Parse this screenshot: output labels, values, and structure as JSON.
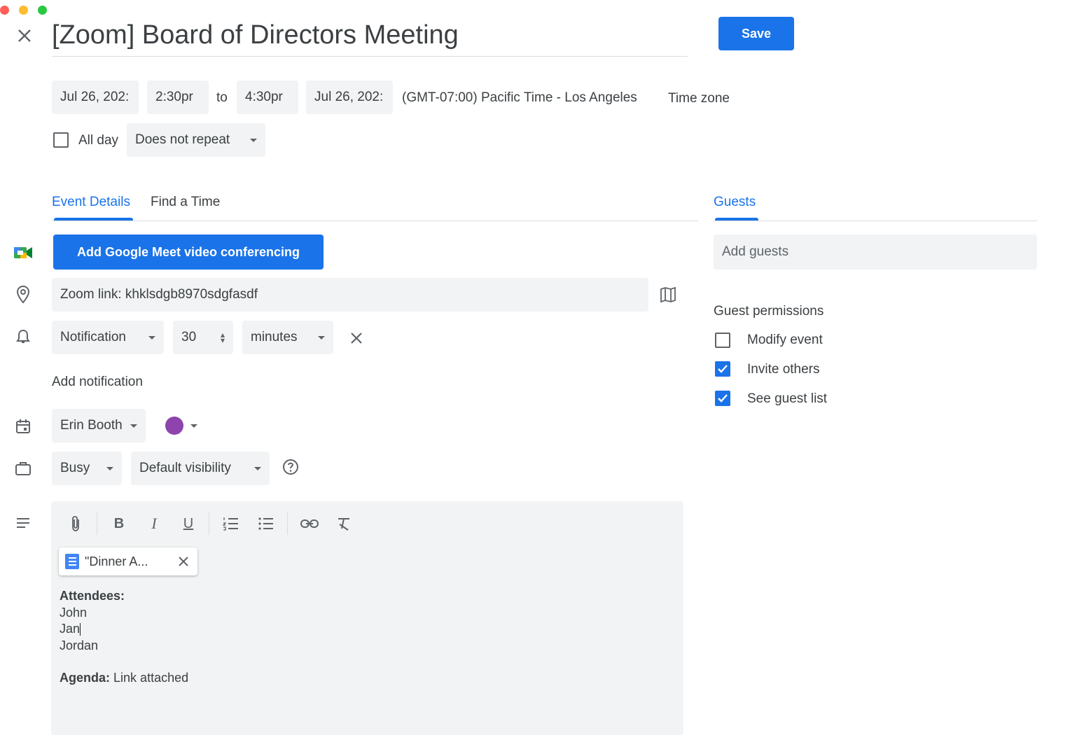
{
  "window": {
    "dots": [
      "#ff5f57",
      "#febc2e",
      "#28c840"
    ]
  },
  "header": {
    "title": "[Zoom] Board of Directors Meeting",
    "save_label": "Save"
  },
  "datetime": {
    "start_date": "Jul 26, 202:",
    "start_time": "2:30pr",
    "to_label": "to",
    "end_time": "4:30pr",
    "end_date": "Jul 26, 202:",
    "timezone_text": "(GMT-07:00) Pacific Time - Los Angeles",
    "timezone_link": "Time zone"
  },
  "allday": {
    "label": "All day",
    "checked": false
  },
  "repeat": {
    "value": "Does not repeat"
  },
  "tabs": [
    {
      "label": "Event Details",
      "active": true
    },
    {
      "label": "Find a Time",
      "active": false
    }
  ],
  "guests_tab": {
    "label": "Guests"
  },
  "meet": {
    "label": "Add Google Meet video conferencing"
  },
  "location": {
    "value": "Zoom link: khklsdgb8970sdgfasdf"
  },
  "notification": {
    "type": "Notification",
    "amount": "30",
    "unit": "minutes"
  },
  "add_notification": "Add notification",
  "calendar": {
    "owner": "Erin Booth",
    "color": "#8e44ad"
  },
  "availability": {
    "status": "Busy",
    "visibility": "Default visibility"
  },
  "description": {
    "attachment": "\"Dinner A...",
    "attendees_label": "Attendees",
    "attendees": [
      "John",
      "Jan",
      "Jordan"
    ],
    "agenda_label": "Agenda",
    "agenda_value": "Link attached"
  },
  "guests": {
    "placeholder": "Add guests",
    "permissions_label": "Guest permissions",
    "permissions": [
      {
        "label": "Modify event",
        "checked": false
      },
      {
        "label": "Invite others",
        "checked": true
      },
      {
        "label": "See guest list",
        "checked": true
      }
    ]
  },
  "colors": {
    "accent": "#1a73e8",
    "field_bg": "#f1f3f4"
  }
}
